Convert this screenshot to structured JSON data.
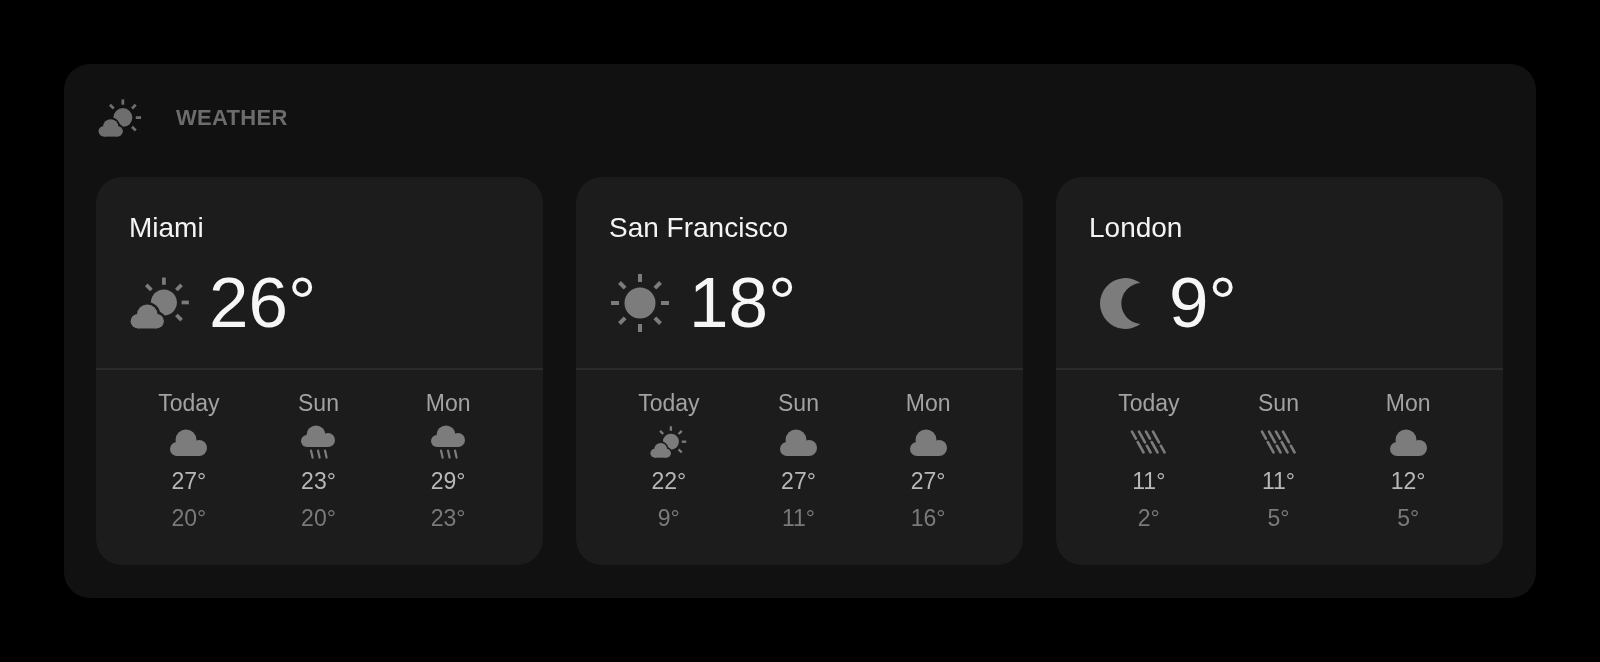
{
  "widget": {
    "title": "WEATHER"
  },
  "cities": [
    {
      "name": "Miami",
      "kind": "suncloud",
      "temperature": "26°",
      "forecast": [
        {
          "day": "Today",
          "kind": "cloud",
          "high": "27°",
          "low": "20°"
        },
        {
          "day": "Sun",
          "kind": "raincloud",
          "high": "23°",
          "low": "20°"
        },
        {
          "day": "Mon",
          "kind": "raincloud",
          "high": "29°",
          "low": "23°"
        }
      ]
    },
    {
      "name": "San Francisco",
      "kind": "sun",
      "temperature": "18°",
      "forecast": [
        {
          "day": "Today",
          "kind": "suncloud",
          "high": "22°",
          "low": "9°"
        },
        {
          "day": "Sun",
          "kind": "cloud",
          "high": "27°",
          "low": "11°"
        },
        {
          "day": "Mon",
          "kind": "cloud",
          "high": "27°",
          "low": "16°"
        }
      ]
    },
    {
      "name": "London",
      "kind": "moon",
      "temperature": "9°",
      "forecast": [
        {
          "day": "Today",
          "kind": "streaks",
          "high": "11°",
          "low": "2°"
        },
        {
          "day": "Sun",
          "kind": "streaks",
          "high": "11°",
          "low": "5°"
        },
        {
          "day": "Mon",
          "kind": "cloud",
          "high": "12°",
          "low": "5°"
        }
      ]
    }
  ]
}
